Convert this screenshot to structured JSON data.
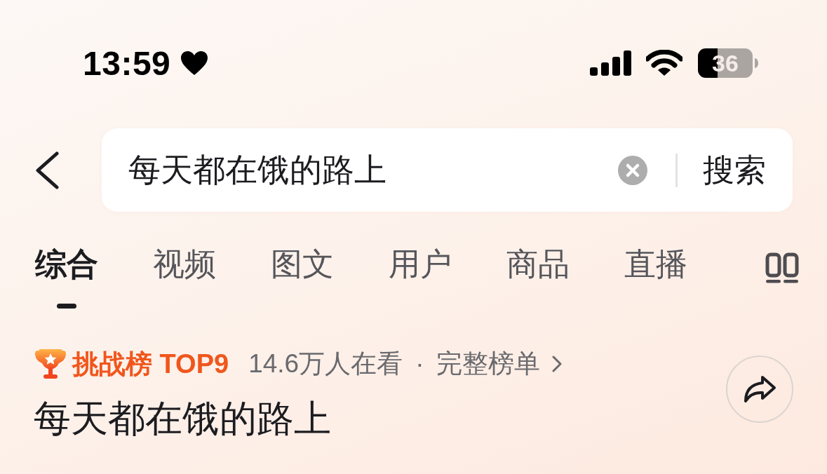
{
  "status_bar": {
    "time": "13:59",
    "battery": "36"
  },
  "search": {
    "value": "每天都在饿的路上",
    "button": "搜索"
  },
  "tabs": [
    {
      "label": "综合",
      "selected": true
    },
    {
      "label": "视频",
      "selected": false
    },
    {
      "label": "图文",
      "selected": false
    },
    {
      "label": "用户",
      "selected": false
    },
    {
      "label": "商品",
      "selected": false
    },
    {
      "label": "直播",
      "selected": false
    }
  ],
  "challenge": {
    "badge": "挑战榜 TOP9",
    "viewers": "14.6万人在看",
    "separator": "·",
    "link": "完整榜单"
  },
  "title": "每天都在饿的路上"
}
